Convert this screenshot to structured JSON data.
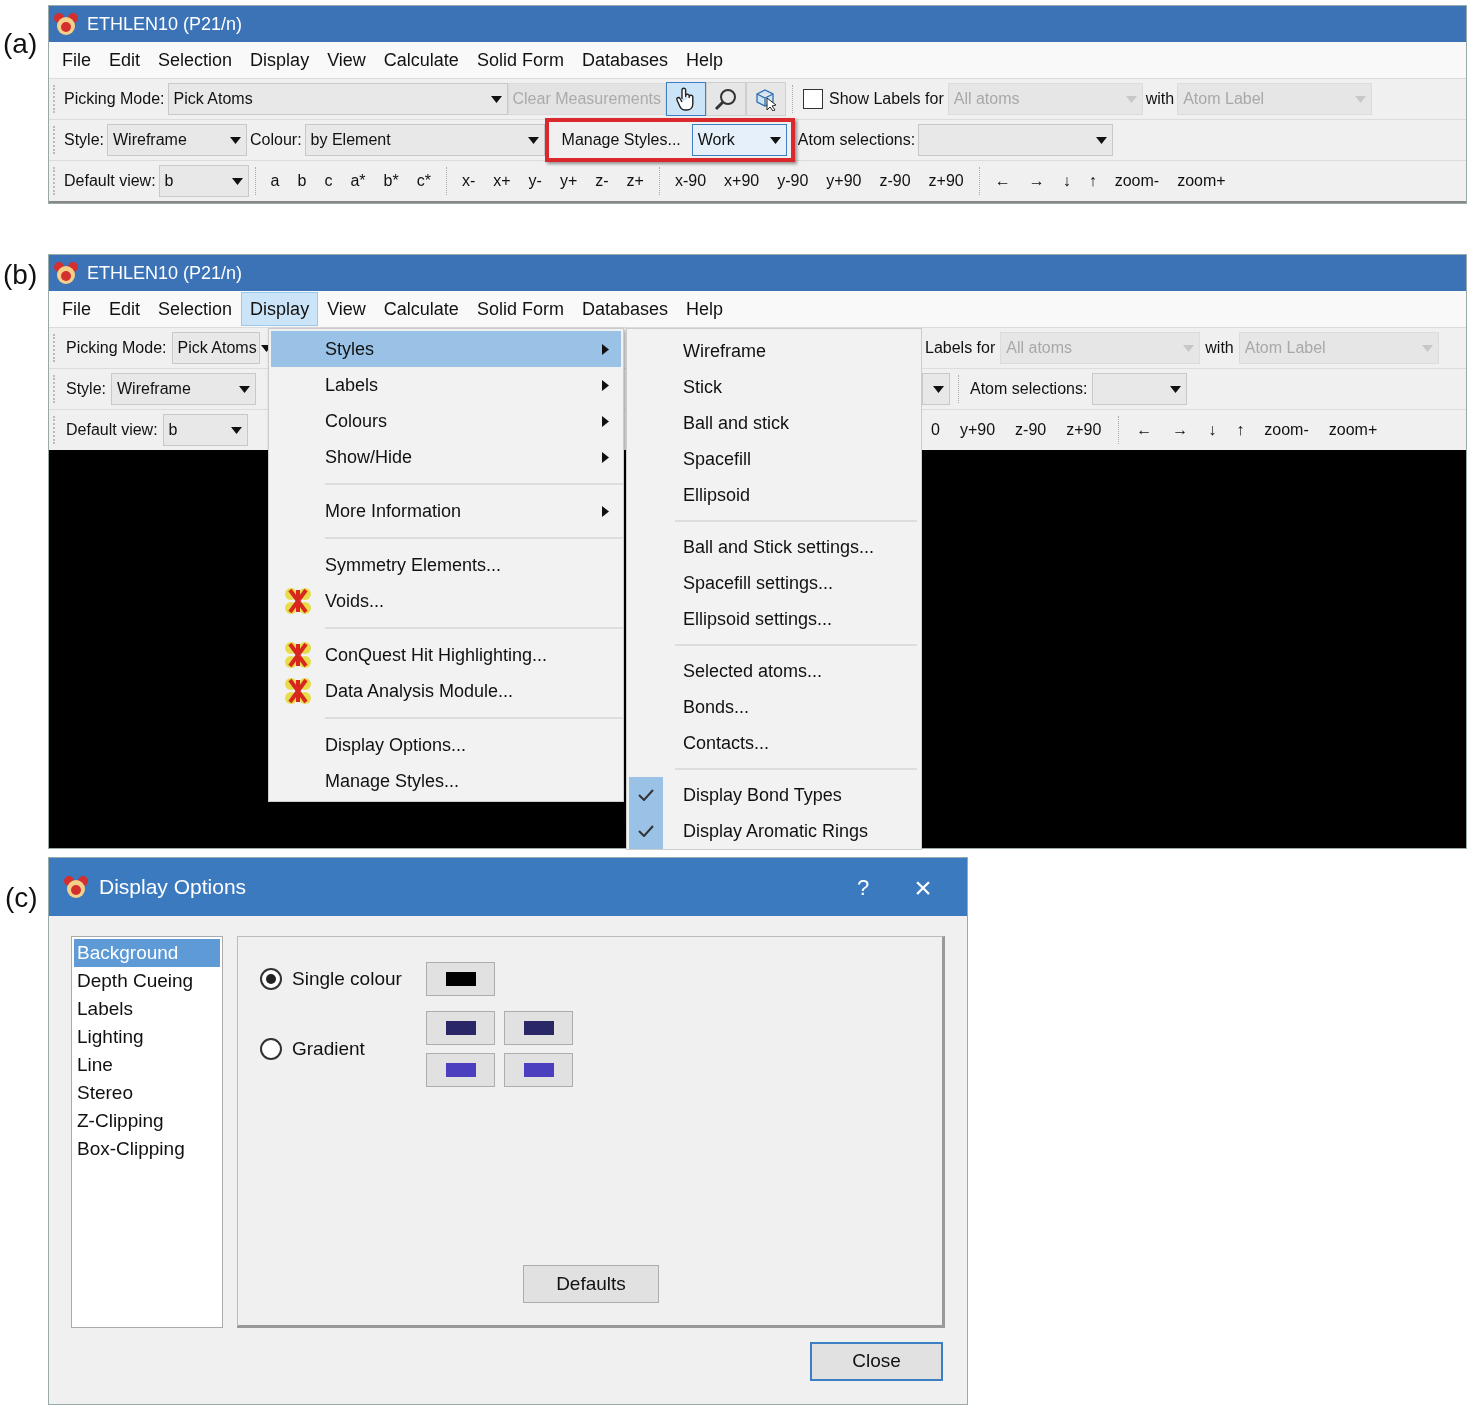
{
  "panel_a": {
    "label": "(a)",
    "window_title": "ETHLEN10 (P21/n)",
    "menu": [
      {
        "text": "File",
        "selected": false
      },
      {
        "text": "Edit",
        "selected": false
      },
      {
        "text": "Selection",
        "selected": false
      },
      {
        "text": "Display",
        "selected": false
      },
      {
        "text": "View",
        "selected": false
      },
      {
        "text": "Calculate",
        "selected": false
      },
      {
        "text": "Solid Form",
        "selected": false
      },
      {
        "text": "Databases",
        "selected": false
      },
      {
        "text": "Help",
        "selected": false
      }
    ],
    "toolbar": [
      [
        {
          "kind": "label",
          "text": "Picking Mode:"
        },
        {
          "kind": "combo",
          "value": "Pick Atoms",
          "disabled": false
        },
        {
          "kind": "button",
          "text": "Clear Measurements",
          "disabled": true
        },
        {
          "kind": "tool",
          "selected": true
        },
        {
          "kind": "tool",
          "selected": false
        },
        {
          "kind": "tool",
          "selected": false
        },
        {
          "kind": "sep"
        },
        {
          "kind": "checkbox",
          "text": "Show Labels for",
          "checked": false
        },
        {
          "kind": "combo",
          "value": "All atoms",
          "disabled": true
        },
        {
          "kind": "label",
          "text": "with"
        },
        {
          "kind": "combo",
          "value": "Atom Label",
          "disabled": true
        }
      ],
      [
        {
          "kind": "label",
          "text": "Style:"
        },
        {
          "kind": "combo",
          "value": "Wireframe",
          "disabled": false
        },
        {
          "kind": "label",
          "text": "Colour:"
        },
        {
          "kind": "combo",
          "value": "by Element",
          "disabled": false
        },
        {
          "kind": "group",
          "highlighted": true,
          "items": [
            {
              "kind": "flat",
              "text": "Manage Styles..."
            },
            {
              "kind": "combo",
              "value": "Work",
              "disabled": false,
              "selected": true
            }
          ]
        },
        {
          "kind": "label",
          "text": "Atom selections:"
        },
        {
          "kind": "combo",
          "disabled": false
        }
      ],
      [
        {
          "kind": "label",
          "text": "Default view:"
        },
        {
          "kind": "combo",
          "value": "b",
          "disabled": false
        },
        {
          "kind": "sep"
        },
        {
          "kind": "flat",
          "text": "a"
        },
        {
          "kind": "flat",
          "text": "b"
        },
        {
          "kind": "flat",
          "text": "c"
        },
        {
          "kind": "flat",
          "text": "a*"
        },
        {
          "kind": "flat",
          "text": "b*"
        },
        {
          "kind": "flat",
          "text": "c*"
        },
        {
          "kind": "sep"
        },
        {
          "kind": "flat",
          "text": "x-"
        },
        {
          "kind": "flat",
          "text": "x+"
        },
        {
          "kind": "flat",
          "text": "y-"
        },
        {
          "kind": "flat",
          "text": "y+"
        },
        {
          "kind": "flat",
          "text": "z-"
        },
        {
          "kind": "flat",
          "text": "z+"
        },
        {
          "kind": "sep"
        },
        {
          "kind": "flat",
          "text": "x-90"
        },
        {
          "kind": "flat",
          "text": "x+90"
        },
        {
          "kind": "flat",
          "text": "y-90"
        },
        {
          "kind": "flat",
          "text": "y+90"
        },
        {
          "kind": "flat",
          "text": "z-90"
        },
        {
          "kind": "flat",
          "text": "z+90"
        },
        {
          "kind": "sep"
        },
        {
          "kind": "flat",
          "text": "←"
        },
        {
          "kind": "flat",
          "text": "→"
        },
        {
          "kind": "flat",
          "text": "↓"
        },
        {
          "kind": "flat",
          "text": "↑"
        },
        {
          "kind": "flat",
          "text": "zoom-"
        },
        {
          "kind": "flat",
          "text": "zoom+"
        }
      ]
    ]
  },
  "panel_b": {
    "label": "(b)",
    "window_title": "ETHLEN10 (P21/n)",
    "menu": [
      {
        "text": "File",
        "selected": false
      },
      {
        "text": "Edit",
        "selected": false
      },
      {
        "text": "Selection",
        "selected": false
      },
      {
        "text": "Display",
        "selected": true
      },
      {
        "text": "View",
        "selected": false
      },
      {
        "text": "Calculate",
        "selected": false
      },
      {
        "text": "Solid Form",
        "selected": false
      },
      {
        "text": "Databases",
        "selected": false
      },
      {
        "text": "Help",
        "selected": false
      }
    ],
    "toolbar": [
      {
        "left": [
          {
            "kind": "label",
            "text": "Picking Mode:"
          },
          {
            "kind": "combo",
            "value": "Pick Atoms",
            "disabled": false
          }
        ],
        "right": [
          {
            "kind": "label",
            "text": "Labels for"
          },
          {
            "kind": "combo",
            "value": "All atoms",
            "disabled": true
          },
          {
            "kind": "label",
            "text": "with"
          },
          {
            "kind": "combo",
            "value": "Atom Label",
            "disabled": true
          }
        ]
      },
      {
        "left": [
          {
            "kind": "label",
            "text": "Style:"
          },
          {
            "kind": "combo",
            "value": "Wireframe",
            "disabled": false
          }
        ],
        "right": [
          {
            "kind": "combo",
            "disabled": false
          },
          {
            "kind": "sep"
          },
          {
            "kind": "label",
            "text": "Atom selections:"
          },
          {
            "kind": "combo",
            "disabled": false
          }
        ]
      },
      {
        "left": [
          {
            "kind": "label",
            "text": "Default view:"
          },
          {
            "kind": "combo",
            "value": "b",
            "disabled": false
          }
        ],
        "right": [
          {
            "kind": "flat",
            "text": "0"
          },
          {
            "kind": "flat",
            "text": "y+90"
          },
          {
            "kind": "flat",
            "text": "z-90"
          },
          {
            "kind": "flat",
            "text": "z+90"
          },
          {
            "kind": "sep"
          },
          {
            "kind": "flat",
            "text": "←"
          },
          {
            "kind": "flat",
            "text": "→"
          },
          {
            "kind": "flat",
            "text": "↓"
          },
          {
            "kind": "flat",
            "text": "↑"
          },
          {
            "kind": "flat",
            "text": "zoom-"
          },
          {
            "kind": "flat",
            "text": "zoom+"
          }
        ]
      }
    ],
    "display_menu": [
      {
        "kind": "submenu",
        "text": "Styles",
        "selected": true,
        "has_icon": false
      },
      {
        "kind": "submenu",
        "text": "Labels",
        "selected": false,
        "has_icon": false
      },
      {
        "kind": "submenu",
        "text": "Colours",
        "selected": false,
        "has_icon": false
      },
      {
        "kind": "submenu",
        "text": "Show/Hide",
        "selected": false,
        "has_icon": false
      },
      {
        "kind": "sep"
      },
      {
        "kind": "submenu",
        "text": "More Information",
        "selected": false,
        "has_icon": false
      },
      {
        "kind": "sep"
      },
      {
        "kind": "item",
        "text": "Symmetry Elements...",
        "selected": false,
        "has_icon": false
      },
      {
        "kind": "item",
        "text": "Voids...",
        "selected": false,
        "has_icon": true
      },
      {
        "kind": "sep"
      },
      {
        "kind": "item",
        "text": "ConQuest Hit Highlighting...",
        "selected": false,
        "has_icon": true
      },
      {
        "kind": "item",
        "text": "Data Analysis Module...",
        "selected": false,
        "has_icon": true
      },
      {
        "kind": "sep"
      },
      {
        "kind": "item",
        "text": "Display Options...",
        "selected": false,
        "has_icon": false
      },
      {
        "kind": "item",
        "text": "Manage Styles...",
        "selected": false,
        "has_icon": false
      }
    ],
    "styles_submenu": [
      {
        "kind": "item",
        "text": "Wireframe",
        "checked": false
      },
      {
        "kind": "item",
        "text": "Stick",
        "checked": false
      },
      {
        "kind": "item",
        "text": "Ball and stick",
        "checked": false
      },
      {
        "kind": "item",
        "text": "Spacefill",
        "checked": false
      },
      {
        "kind": "item",
        "text": "Ellipsoid",
        "checked": false
      },
      {
        "kind": "sep"
      },
      {
        "kind": "item",
        "text": "Ball and Stick settings...",
        "checked": false
      },
      {
        "kind": "item",
        "text": "Spacefill settings...",
        "checked": false
      },
      {
        "kind": "item",
        "text": "Ellipsoid settings...",
        "checked": false
      },
      {
        "kind": "sep"
      },
      {
        "kind": "item",
        "text": "Selected atoms...",
        "checked": false
      },
      {
        "kind": "item",
        "text": "Bonds...",
        "checked": false
      },
      {
        "kind": "item",
        "text": "Contacts...",
        "checked": false
      },
      {
        "kind": "sep"
      },
      {
        "kind": "item",
        "text": "Display Bond Types",
        "checked": true
      },
      {
        "kind": "item",
        "text": "Display Aromatic Rings",
        "checked": true
      }
    ]
  },
  "panel_c": {
    "label": "(c)",
    "dialog_title": "Display Options",
    "help": "?",
    "close": "×",
    "categories": [
      {
        "text": "Background",
        "selected": true
      },
      {
        "text": "Depth Cueing",
        "selected": false
      },
      {
        "text": "Labels",
        "selected": false
      },
      {
        "text": "Lighting",
        "selected": false
      },
      {
        "text": "Line",
        "selected": false
      },
      {
        "text": "Stereo",
        "selected": false
      },
      {
        "text": "Z-Clipping",
        "selected": false
      },
      {
        "text": "Box-Clipping",
        "selected": false
      }
    ],
    "options": [
      {
        "text": "Single colour",
        "selected": true,
        "swatches": [
          {
            "color": "#000000"
          }
        ]
      },
      {
        "text": "Gradient",
        "selected": false,
        "swatches": [
          {
            "color": "#2a2766"
          },
          {
            "color": "#2a2766"
          },
          {
            "color": "#4b3fbf"
          },
          {
            "color": "#4b3fbf"
          }
        ]
      }
    ],
    "defaults_button": "Defaults",
    "close_button": "Close"
  }
}
